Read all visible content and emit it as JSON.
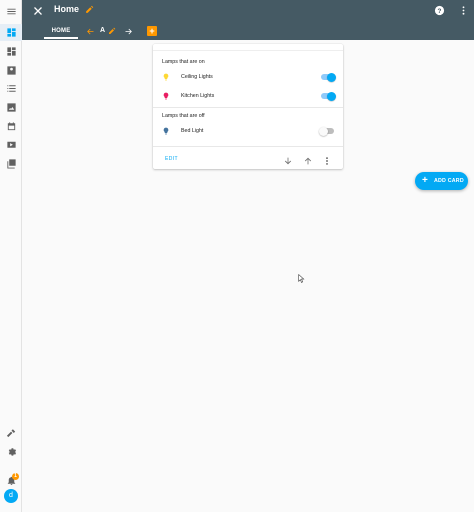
{
  "header": {
    "title": "Home",
    "tabs": [
      {
        "label": "HOME"
      }
    ],
    "view_badge": "A",
    "add_view_symbol": "+"
  },
  "card": {
    "sections": [
      {
        "title": "Lamps that are on",
        "entities": [
          {
            "name": "Ceiling Lights",
            "icon": "bulb-icon",
            "color": "#fdd835",
            "state": "on"
          },
          {
            "name": "Kitchen Lights",
            "icon": "bulb-icon",
            "color": "#e91e63",
            "state": "on"
          }
        ]
      },
      {
        "title": "Lamps that are off",
        "entities": [
          {
            "name": "Bed Light",
            "icon": "bulb-icon",
            "color": "#44739e",
            "state": "off"
          }
        ]
      }
    ],
    "edit_label": "EDIT"
  },
  "fab": {
    "plus": "+",
    "label": "ADD CARD"
  },
  "sidebar": {
    "notification_count": "1",
    "avatar_initial": "d"
  },
  "colors": {
    "header_bg": "#455a64",
    "accent": "#03a9f4",
    "edit_mode_accent": "#ff9800"
  }
}
